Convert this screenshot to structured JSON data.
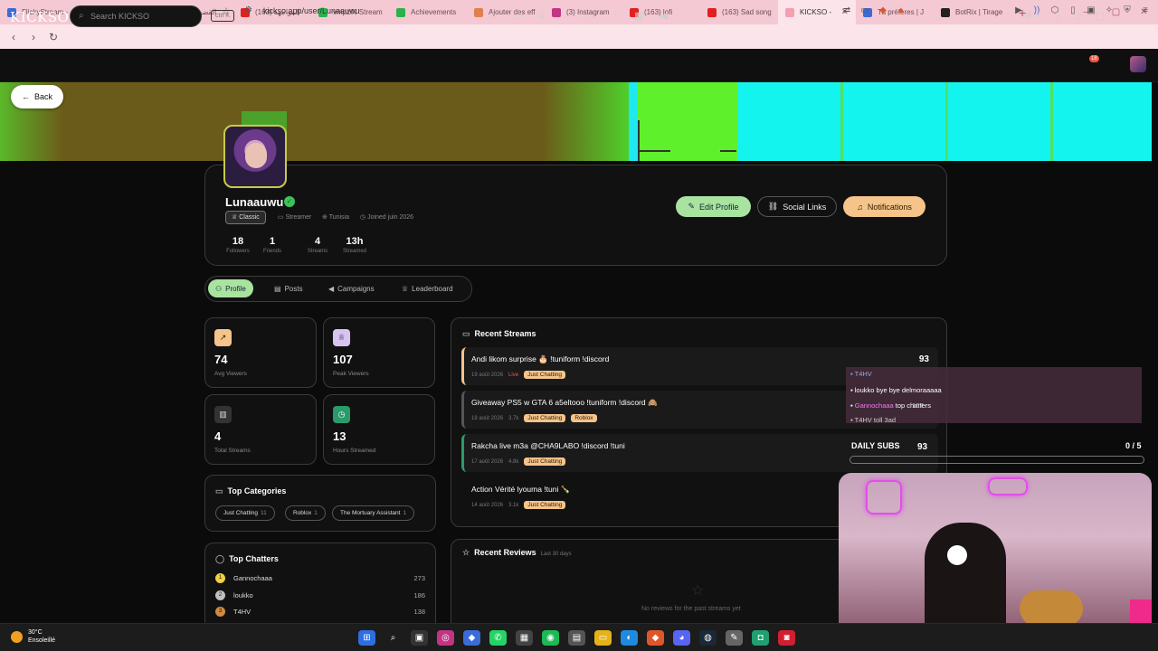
{
  "browser": {
    "tabs": [
      {
        "label": "FlickyStream -",
        "color": "#3b6bd6"
      },
      {
        "label": "mobalytics.gg",
        "color": "#6a6a9a"
      },
      {
        "label": "(163) القضية",
        "color": "#e02020"
      },
      {
        "label": "(163) المواجهة",
        "color": "#e02020"
      },
      {
        "label": "vmpziN Stream",
        "color": "#2bb24c"
      },
      {
        "label": "Achievements",
        "color": "#2bb24c"
      },
      {
        "label": "Ajouter des eff",
        "color": "#e08050"
      },
      {
        "label": "(3) Instagram",
        "color": "#c13584"
      },
      {
        "label": "(163) lofi",
        "color": "#e02020"
      },
      {
        "label": "(163) Sad song",
        "color": "#e02020"
      },
      {
        "label": "KICKSO -",
        "color": "#f4a0b0",
        "active": true
      },
      {
        "label": "Tu préfères | J",
        "color": "#3b6bd6"
      },
      {
        "label": "BotRix | Tirage",
        "color": "#222222"
      }
    ],
    "new_tab": "+",
    "url": "kickso.app/user/Lunaauwu",
    "window_controls": [
      "—",
      "▢",
      "✕"
    ]
  },
  "site": {
    "logo": "KICKSO",
    "search_placeholder": "Search KICKSO",
    "shortcut": "ctrl K",
    "lang": "E",
    "notif_count": "18"
  },
  "back_label": "Back",
  "profile": {
    "username": "Lunaauwu",
    "role_badge": "Classic",
    "type": "Streamer",
    "country": "Tunisia",
    "joined": "Joined juin 2026",
    "stats": [
      {
        "value": "18",
        "label": "Followers"
      },
      {
        "value": "1",
        "label": "Friends"
      },
      {
        "value": "4",
        "label": "Streams"
      },
      {
        "value": "13h",
        "label": "Streamed"
      }
    ],
    "edit_label": "Edit Profile",
    "social_label": "Social Links",
    "notif_label": "Notifications"
  },
  "tabs": [
    "Profile",
    "Posts",
    "Campaigns",
    "Leaderboard"
  ],
  "stat_cards": [
    {
      "value": "74",
      "label": "Avg Viewers",
      "icon": "trending-icon",
      "bg": "#f5c48a"
    },
    {
      "value": "107",
      "label": "Peak Viewers",
      "icon": "trophy-icon",
      "bg": "#d8c4f0"
    },
    {
      "value": "4",
      "label": "Total Streams",
      "icon": "bar-chart-icon",
      "bg": "#333333"
    },
    {
      "value": "13",
      "label": "Hours Streamed",
      "icon": "clock-icon",
      "bg": "#2a9a6a"
    }
  ],
  "top_categories": {
    "title": "Top Categories",
    "items": [
      {
        "name": "Just Chatting",
        "count": "11"
      },
      {
        "name": "Roblox",
        "count": "1"
      },
      {
        "name": "The Mortuary Assistant",
        "count": "1"
      }
    ]
  },
  "top_chatters": {
    "title": "Top Chatters",
    "items": [
      {
        "rank": "1",
        "name": "Gannochaaa",
        "count": "273",
        "color": "#f0d040"
      },
      {
        "rank": "2",
        "name": "loukko",
        "count": "186",
        "color": "#c0c0c0"
      },
      {
        "rank": "3",
        "name": "T4HV",
        "count": "138",
        "color": "#d08a40"
      }
    ]
  },
  "recent_streams": {
    "title": "Recent Streams",
    "items": [
      {
        "title": "Andi likom surprise 🎂 !tuniform !discord",
        "date": "19 août 2026",
        "status": "Live",
        "views": "",
        "tags": [
          "Just Chatting"
        ],
        "peak": "93"
      },
      {
        "title": "Giveaway PS5 w GTA 6 a5eltooo !tuniform !discord 🙈",
        "date": "18 août 2026",
        "status": "",
        "views": "3.7k",
        "tags": [
          "Just Chatting",
          "Roblox"
        ],
        "peak": ""
      },
      {
        "title": "Rakcha live m3a @CHA9LABO !discord !tuni",
        "date": "17 août 2026",
        "status": "",
        "views": "4.8k",
        "tags": [
          "Just Chatting"
        ],
        "peak": ""
      },
      {
        "title": "Action Vérité lyouma !tuni 🍾",
        "date": "14 août 2026",
        "status": "",
        "views": "3.1k",
        "tags": [
          "Just Chatting"
        ],
        "peak": ""
      }
    ]
  },
  "recent_reviews": {
    "title": "Recent Reviews",
    "subtitle": "Last 30 days",
    "empty": "No reviews for the past streams yet"
  },
  "overlay": {
    "chat": [
      {
        "user": "T4HV",
        "text": ""
      },
      {
        "user": "loukko",
        "text": "bye bye delmoraaaaa"
      },
      {
        "user": "Gannochaaa",
        "text": "top chatters"
      },
      {
        "user": "T4HV",
        "text": "toll 3ad"
      }
    ],
    "daily_subs_label": "DAILY SUBS",
    "daily_subs_value": "0 / 5",
    "peak_overlay": "107",
    "daily_subs_progress": 0.0
  },
  "taskbar": {
    "temp": "30°C",
    "condition": "Ensoleillé"
  }
}
